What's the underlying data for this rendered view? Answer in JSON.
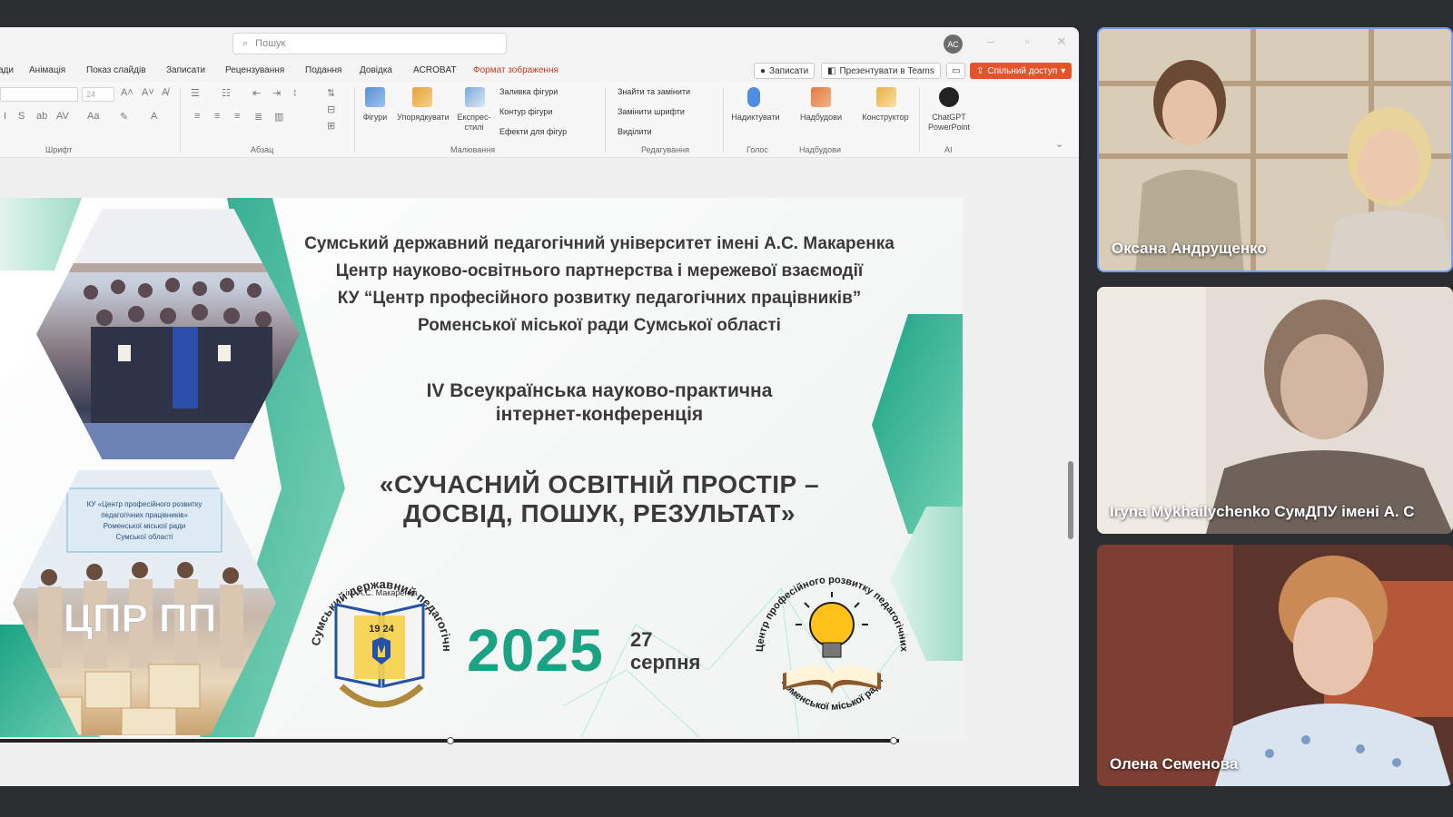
{
  "ppt": {
    "search_placeholder": "Пошук",
    "avatar": "АС",
    "menu": [
      {
        "label": "ади"
      },
      {
        "label": "Анімація"
      },
      {
        "label": "Показ слайдів"
      },
      {
        "label": "Записати"
      },
      {
        "label": "Рецензування"
      },
      {
        "label": "Подання"
      },
      {
        "label": "Довідка"
      },
      {
        "label": "ACROBAT"
      },
      {
        "label": "Формат зображення"
      }
    ],
    "buttons": {
      "record": "Записати",
      "present_teams": "Презентувати в Teams",
      "share": "Спільний доступ"
    },
    "ribbon": {
      "font_size": "24",
      "group_font": "Шрифт",
      "group_paragraph": "Абзац",
      "shapes": "Фігури",
      "arrange": "Упорядкувати",
      "express_styles": "Експрес-стилі",
      "shape_fill": "Заливка фігури",
      "shape_outline": "Контур фігури",
      "shape_effects": "Ефекти для фігур",
      "group_drawing": "Малювання",
      "find_replace": "Знайти та замінити",
      "replace_font": "Замінити шрифти",
      "select": "Виділити",
      "group_editing": "Редагування",
      "dictate": "Надиктувати",
      "group_voice": "Голос",
      "add_ins": "Надбудови",
      "group_addins": "Надбудови",
      "designer": "Конструктор",
      "chatgpt": "ChatGPT PowerPoint",
      "group_ai": "AI"
    }
  },
  "slide": {
    "header_lines": [
      "Сумський державний педагогічний університет імені А.С. Макаренка",
      "Центр науково-освітнього партнерства і мережевої взаємодії",
      "КУ “Центр професійного розвитку педагогічних працівників”",
      "Роменської міської ради Сумської області"
    ],
    "conference_lines": [
      "IV Всеукраїнська науково-практична",
      "інтернет-конференція"
    ],
    "title_lines": [
      "«СУЧАСНИЙ ОСВІТНІЙ ПРОСТІР –",
      "ДОСВІД, ПОШУК, РЕЗУЛЬТАТ»"
    ],
    "year": "2025",
    "day": "27",
    "month": "серпня",
    "photo2_banner": "КУ «Центр професійного розвитку педагогічних працівників» Роменської міської ради Сумської області",
    "photo2_letters": "ЦПР ПП",
    "logo_left": {
      "ring_text": "Сумський державний педагогічний університет",
      "subtitle": "ім. А.С. Макаренка",
      "year": "19 24"
    },
    "logo_right": {
      "ring_text": "Центр професійного розвитку педагогічних працівників",
      "bottom_text": "Роменської міської ради"
    }
  },
  "participants": [
    {
      "name": "Оксана Андрущенко"
    },
    {
      "name": "Iryna Mykhailychenko СумДПУ імені А. С"
    },
    {
      "name": "Олена Семенова"
    }
  ],
  "colors": {
    "accent_green": "#1aa383",
    "share_orange": "#e5532b",
    "active_speaker_border": "#6e9cff"
  }
}
